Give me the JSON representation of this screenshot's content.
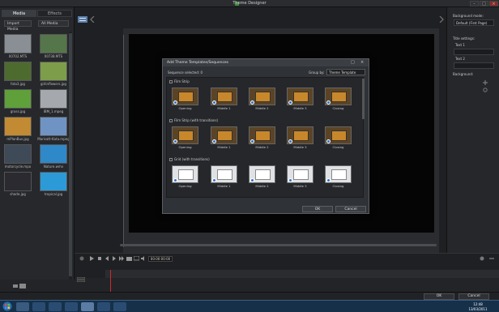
{
  "window": {
    "title": "Theme Designer"
  },
  "sidebar": {
    "tabs": [
      "Media",
      "Effects"
    ],
    "import_label": "Import Media",
    "filter_label": "All Media",
    "media": [
      {
        "label": "00702.MTS",
        "color": "#8a8f96"
      },
      {
        "label": "00738.MTS",
        "color": "#55764a"
      },
      {
        "label": "foto3.jpg",
        "color": "#4d6b2f"
      },
      {
        "label": "girlinflowers.jpg",
        "color": "#7d9d4a"
      },
      {
        "label": "grass.jpg",
        "color": "#5fa03a"
      },
      {
        "label": "IBM_1.mpeg",
        "color": "#a5a8ad"
      },
      {
        "label": "mPlanBus.jpg",
        "color": "#c28a32"
      },
      {
        "label": "Marisatt-Kata.mpeg",
        "color": "#6f94c4"
      },
      {
        "label": "motorcycle.mpo",
        "color": "#3f4a58"
      },
      {
        "label": "Nature.wmv",
        "color": "#2f88c8"
      },
      {
        "label": "shade.jpg",
        "color": "#2a2a30"
      },
      {
        "label": "tropical.jpg",
        "color": "#2c9ad6"
      }
    ]
  },
  "right_panel": {
    "bg_mode_label": "Background mode:",
    "bg_mode_value": "Default (First Page)",
    "title_settings": "Title settings:",
    "text1": "Text 1",
    "text2": "Text 2",
    "background": "Background:"
  },
  "dialog": {
    "title": "Add Theme Templates/Sequences",
    "selected": "Sequence selected: 0",
    "group_by_label": "Group by:",
    "group_by_value": "Theme Template",
    "groups": [
      {
        "name": "Film Strip",
        "style": "film",
        "items": [
          "Opening",
          "Middle 1",
          "Middle 2",
          "Middle 3",
          "Closing"
        ]
      },
      {
        "name": "Film Strip (with transitions)",
        "style": "film",
        "items": [
          "Opening",
          "Middle 1",
          "Middle 2",
          "Middle 3",
          "Closing"
        ]
      },
      {
        "name": "Grid (with transitions)",
        "style": "grid",
        "items": [
          "Opening",
          "Middle 1",
          "Middle 2",
          "Middle 3",
          "Closing"
        ]
      }
    ],
    "ok": "OK",
    "cancel": "Cancel"
  },
  "timeline": {
    "timecode": "00:00:00:00"
  },
  "footer": {
    "ok": "OK",
    "cancel": "Cancel"
  },
  "clock": {
    "time": "12:48",
    "date": "13/03/2011"
  }
}
